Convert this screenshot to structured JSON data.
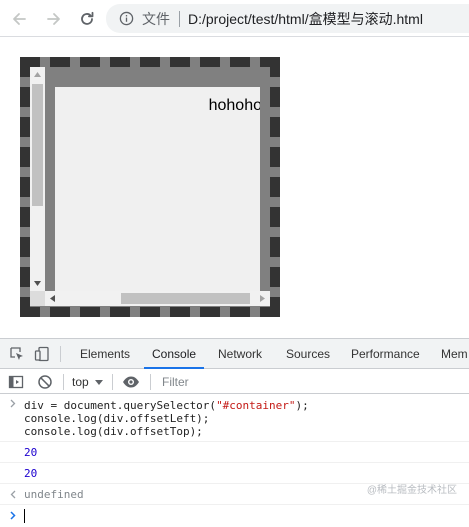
{
  "browser": {
    "address_scheme": "文件",
    "address_url": "D:/project/test/html/盒模型与滚动.html"
  },
  "page": {
    "container_text": "hohoho"
  },
  "devtools": {
    "tabs": [
      "Elements",
      "Console",
      "Network",
      "Sources",
      "Performance",
      "Mem"
    ],
    "active_tab": "Console",
    "context": "top",
    "filter_placeholder": "Filter",
    "console": {
      "input_lines": [
        "div = document.querySelector(\"#container\");",
        "console.log(div.offsetLeft);",
        "console.log(div.offsetTop);"
      ],
      "outputs": [
        "20",
        "20"
      ],
      "return_value": "undefined"
    },
    "watermark": "@稀土掘金技术社区"
  },
  "colors": {
    "accent": "#1a73e8",
    "container_bg": "#808080",
    "container_border": "#333333",
    "number_output": "#1c00cf"
  }
}
